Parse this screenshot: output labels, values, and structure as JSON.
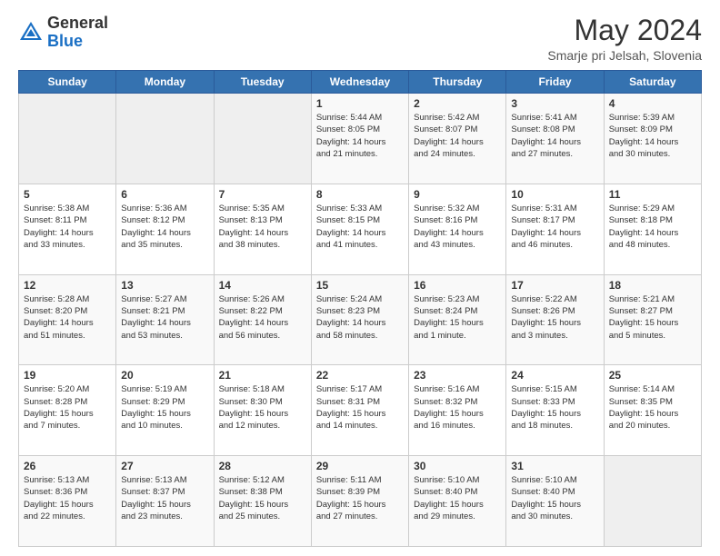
{
  "header": {
    "logo_general": "General",
    "logo_blue": "Blue",
    "month_year": "May 2024",
    "location": "Smarje pri Jelsah, Slovenia"
  },
  "days_of_week": [
    "Sunday",
    "Monday",
    "Tuesday",
    "Wednesday",
    "Thursday",
    "Friday",
    "Saturday"
  ],
  "weeks": [
    [
      {
        "date": "",
        "info": ""
      },
      {
        "date": "",
        "info": ""
      },
      {
        "date": "",
        "info": ""
      },
      {
        "date": "1",
        "info": "Sunrise: 5:44 AM\nSunset: 8:05 PM\nDaylight: 14 hours\nand 21 minutes."
      },
      {
        "date": "2",
        "info": "Sunrise: 5:42 AM\nSunset: 8:07 PM\nDaylight: 14 hours\nand 24 minutes."
      },
      {
        "date": "3",
        "info": "Sunrise: 5:41 AM\nSunset: 8:08 PM\nDaylight: 14 hours\nand 27 minutes."
      },
      {
        "date": "4",
        "info": "Sunrise: 5:39 AM\nSunset: 8:09 PM\nDaylight: 14 hours\nand 30 minutes."
      }
    ],
    [
      {
        "date": "5",
        "info": "Sunrise: 5:38 AM\nSunset: 8:11 PM\nDaylight: 14 hours\nand 33 minutes."
      },
      {
        "date": "6",
        "info": "Sunrise: 5:36 AM\nSunset: 8:12 PM\nDaylight: 14 hours\nand 35 minutes."
      },
      {
        "date": "7",
        "info": "Sunrise: 5:35 AM\nSunset: 8:13 PM\nDaylight: 14 hours\nand 38 minutes."
      },
      {
        "date": "8",
        "info": "Sunrise: 5:33 AM\nSunset: 8:15 PM\nDaylight: 14 hours\nand 41 minutes."
      },
      {
        "date": "9",
        "info": "Sunrise: 5:32 AM\nSunset: 8:16 PM\nDaylight: 14 hours\nand 43 minutes."
      },
      {
        "date": "10",
        "info": "Sunrise: 5:31 AM\nSunset: 8:17 PM\nDaylight: 14 hours\nand 46 minutes."
      },
      {
        "date": "11",
        "info": "Sunrise: 5:29 AM\nSunset: 8:18 PM\nDaylight: 14 hours\nand 48 minutes."
      }
    ],
    [
      {
        "date": "12",
        "info": "Sunrise: 5:28 AM\nSunset: 8:20 PM\nDaylight: 14 hours\nand 51 minutes."
      },
      {
        "date": "13",
        "info": "Sunrise: 5:27 AM\nSunset: 8:21 PM\nDaylight: 14 hours\nand 53 minutes."
      },
      {
        "date": "14",
        "info": "Sunrise: 5:26 AM\nSunset: 8:22 PM\nDaylight: 14 hours\nand 56 minutes."
      },
      {
        "date": "15",
        "info": "Sunrise: 5:24 AM\nSunset: 8:23 PM\nDaylight: 14 hours\nand 58 minutes."
      },
      {
        "date": "16",
        "info": "Sunrise: 5:23 AM\nSunset: 8:24 PM\nDaylight: 15 hours\nand 1 minute."
      },
      {
        "date": "17",
        "info": "Sunrise: 5:22 AM\nSunset: 8:26 PM\nDaylight: 15 hours\nand 3 minutes."
      },
      {
        "date": "18",
        "info": "Sunrise: 5:21 AM\nSunset: 8:27 PM\nDaylight: 15 hours\nand 5 minutes."
      }
    ],
    [
      {
        "date": "19",
        "info": "Sunrise: 5:20 AM\nSunset: 8:28 PM\nDaylight: 15 hours\nand 7 minutes."
      },
      {
        "date": "20",
        "info": "Sunrise: 5:19 AM\nSunset: 8:29 PM\nDaylight: 15 hours\nand 10 minutes."
      },
      {
        "date": "21",
        "info": "Sunrise: 5:18 AM\nSunset: 8:30 PM\nDaylight: 15 hours\nand 12 minutes."
      },
      {
        "date": "22",
        "info": "Sunrise: 5:17 AM\nSunset: 8:31 PM\nDaylight: 15 hours\nand 14 minutes."
      },
      {
        "date": "23",
        "info": "Sunrise: 5:16 AM\nSunset: 8:32 PM\nDaylight: 15 hours\nand 16 minutes."
      },
      {
        "date": "24",
        "info": "Sunrise: 5:15 AM\nSunset: 8:33 PM\nDaylight: 15 hours\nand 18 minutes."
      },
      {
        "date": "25",
        "info": "Sunrise: 5:14 AM\nSunset: 8:35 PM\nDaylight: 15 hours\nand 20 minutes."
      }
    ],
    [
      {
        "date": "26",
        "info": "Sunrise: 5:13 AM\nSunset: 8:36 PM\nDaylight: 15 hours\nand 22 minutes."
      },
      {
        "date": "27",
        "info": "Sunrise: 5:13 AM\nSunset: 8:37 PM\nDaylight: 15 hours\nand 23 minutes."
      },
      {
        "date": "28",
        "info": "Sunrise: 5:12 AM\nSunset: 8:38 PM\nDaylight: 15 hours\nand 25 minutes."
      },
      {
        "date": "29",
        "info": "Sunrise: 5:11 AM\nSunset: 8:39 PM\nDaylight: 15 hours\nand 27 minutes."
      },
      {
        "date": "30",
        "info": "Sunrise: 5:10 AM\nSunset: 8:40 PM\nDaylight: 15 hours\nand 29 minutes."
      },
      {
        "date": "31",
        "info": "Sunrise: 5:10 AM\nSunset: 8:40 PM\nDaylight: 15 hours\nand 30 minutes."
      },
      {
        "date": "",
        "info": ""
      }
    ]
  ]
}
